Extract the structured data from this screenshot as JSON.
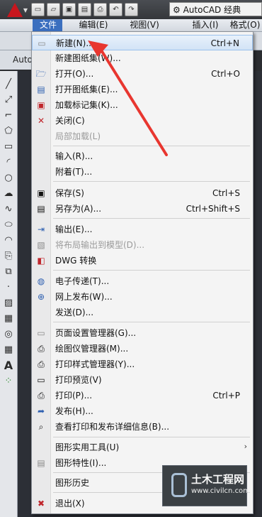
{
  "title_bar": {
    "workspace": "AutoCAD 经典",
    "qat_icons": [
      "new-file-icon",
      "open-folder-icon",
      "save-icon",
      "save-as-icon",
      "print-icon",
      "undo-icon",
      "redo-icon"
    ]
  },
  "menubar": {
    "items": [
      {
        "label": "文件(F)",
        "active": true
      },
      {
        "label": "编辑(E)"
      },
      {
        "label": "视图(V)"
      },
      {
        "label": "插入(I)"
      },
      {
        "label": "格式(O)"
      }
    ]
  },
  "toolbar3": {
    "label": "Auto"
  },
  "file_menu": {
    "items": [
      {
        "label": "新建(N)...",
        "shortcut": "Ctrl+N",
        "icon": "new-file-icon",
        "highlighted": true
      },
      {
        "label": "新建图纸集(W)...",
        "icon": "blank-icon"
      },
      {
        "label": "打开(O)...",
        "shortcut": "Ctrl+O",
        "icon": "open-folder-icon"
      },
      {
        "label": "打开图纸集(E)...",
        "icon": "open-sheetset-icon"
      },
      {
        "label": "加载标记集(K)...",
        "icon": "markup-icon"
      },
      {
        "label": "关闭(C)",
        "icon": "close-doc-icon"
      },
      {
        "label": "局部加载(L)",
        "icon": "blank-icon",
        "disabled": true
      },
      {
        "label": "输入(R)...",
        "icon": "blank-icon"
      },
      {
        "label": "附着(T)...",
        "icon": "blank-icon"
      },
      {
        "label": "保存(S)",
        "shortcut": "Ctrl+S",
        "icon": "save-icon"
      },
      {
        "label": "另存为(A)...",
        "shortcut": "Ctrl+Shift+S",
        "icon": "save-as-icon"
      },
      {
        "label": "输出(E)...",
        "icon": "export-icon"
      },
      {
        "label": "将布局输出到模型(D)...",
        "icon": "layout-export-icon",
        "disabled": true
      },
      {
        "label": "DWG 转换",
        "icon": "dwg-convert-icon"
      },
      {
        "label": "电子传递(T)...",
        "icon": "etransmit-icon"
      },
      {
        "label": "网上发布(W)...",
        "icon": "publish-web-icon"
      },
      {
        "label": "发送(D)...",
        "icon": "blank-icon"
      },
      {
        "label": "页面设置管理器(G)...",
        "icon": "page-setup-icon"
      },
      {
        "label": "绘图仪管理器(M)...",
        "icon": "plotter-icon"
      },
      {
        "label": "打印样式管理器(Y)...",
        "icon": "plot-style-icon"
      },
      {
        "label": "打印预览(V)",
        "icon": "print-preview-icon"
      },
      {
        "label": "打印(P)...",
        "shortcut": "Ctrl+P",
        "icon": "print-icon"
      },
      {
        "label": "发布(H)...",
        "icon": "publish-icon"
      },
      {
        "label": "查看打印和发布详细信息(B)...",
        "icon": "plot-details-icon"
      },
      {
        "label": "图形实用工具(U)",
        "icon": "blank-icon",
        "submenu": true
      },
      {
        "label": "图形特性(I)...",
        "icon": "drawing-properties-icon"
      },
      {
        "label": "图形历史",
        "icon": "blank-icon"
      },
      {
        "label": "退出(X)",
        "icon": "exit-icon"
      }
    ]
  },
  "watermark": {
    "title": "土木工程网",
    "url": "www.civilcn.com"
  },
  "annotation": {
    "arrow_color": "#e8362f"
  }
}
